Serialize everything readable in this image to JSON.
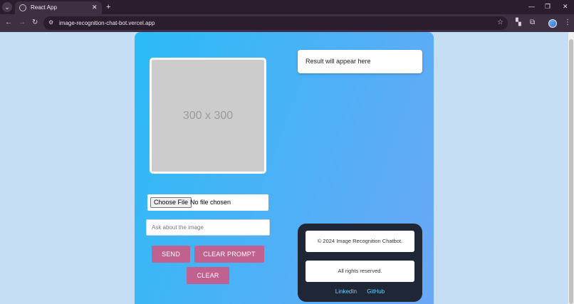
{
  "browser": {
    "tab_title": "React App",
    "tab_close": "✕",
    "new_tab": "+",
    "url": "image-recognition-chat-bot.vercel.app",
    "controls": {
      "minimize": "—",
      "restore": "❐",
      "close": "✕"
    }
  },
  "app": {
    "image_placeholder": "300 x 300",
    "file_input": {
      "button_label": "Choose File",
      "status": "No file chosen"
    },
    "prompt": {
      "placeholder": "Ask about the image",
      "value": ""
    },
    "buttons": {
      "send": "SEND",
      "clear_prompt": "CLEAR PROMPT",
      "clear": "CLEAR"
    },
    "result_text": "Result will appear here",
    "footer": {
      "copyright": "© 2024 Image Recognition Chatbot.",
      "rights": "All rights reserved.",
      "links": [
        "LinkedIn",
        "GitHub"
      ]
    }
  },
  "colors": {
    "button": "#c1618f",
    "gradient_start": "#2cbcf6",
    "gradient_end": "#6ba7f5",
    "footer_bg": "#1f2736",
    "link": "#6fd0f6",
    "page_bg": "#c5def3"
  },
  "icons": [
    "tab-menu-icon",
    "favicon-icon",
    "back-icon",
    "forward-icon",
    "reload-icon",
    "site-info-icon",
    "star-icon",
    "extensions-icon",
    "profile-icon",
    "menu-icon"
  ]
}
